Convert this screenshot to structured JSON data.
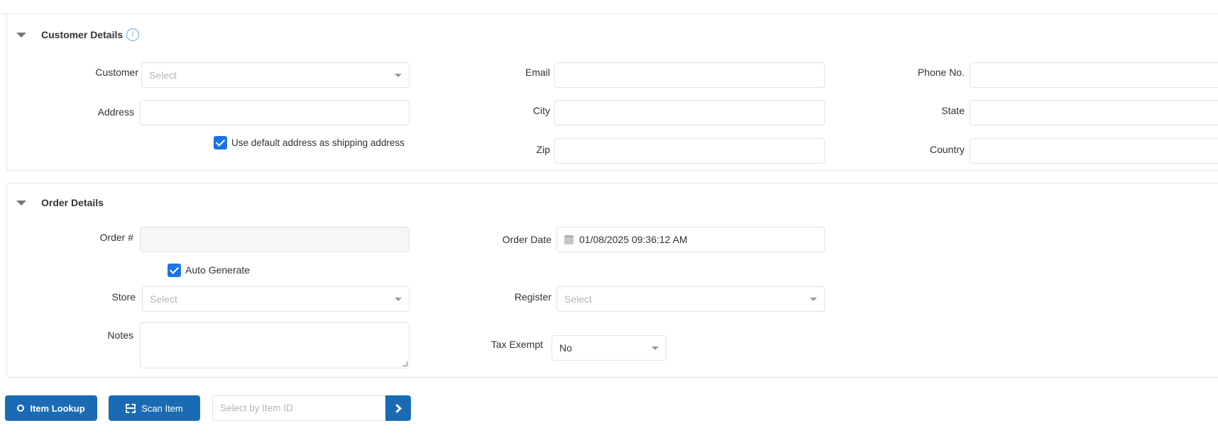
{
  "customer_details": {
    "title": "Customer Details",
    "customer_label": "Customer",
    "customer_placeholder": "Select",
    "address_label": "Address",
    "default_address_checkbox": "Use default address as shipping address",
    "default_address_checked": true,
    "email_label": "Email",
    "city_label": "City",
    "zip_label": "Zip",
    "phone_label": "Phone No.",
    "state_label": "State",
    "country_label": "Country"
  },
  "order_details": {
    "title": "Order Details",
    "order_no_label": "Order #",
    "auto_generate_label": "Auto Generate",
    "auto_generate_checked": true,
    "store_label": "Store",
    "store_placeholder": "Select",
    "notes_label": "Notes",
    "order_date_label": "Order Date",
    "order_date_value": "01/08/2025 09:36:12 AM",
    "register_label": "Register",
    "register_placeholder": "Select",
    "tax_exempt_label": "Tax Exempt",
    "tax_exempt_value": "No"
  },
  "toolbar": {
    "item_lookup": "Item Lookup",
    "scan_item": "Scan Item",
    "item_id_placeholder": "Select by Item ID"
  },
  "colors": {
    "primary": "#1a6bb3",
    "checkbox": "#1a73e8"
  }
}
